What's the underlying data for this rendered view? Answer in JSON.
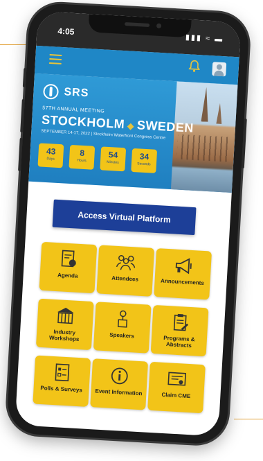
{
  "status_bar": {
    "time": "4:05",
    "signal_icons": "▮▮▮ ≈ ▬"
  },
  "app_bar": {
    "menu_icon": "menu-icon",
    "bell_icon": "bell-icon",
    "profile_icon": "avatar-icon"
  },
  "banner": {
    "logo_text": "SRS",
    "meeting_text": "57TH ANNUAL MEETING",
    "city_left": "STOCKHOLM",
    "city_right": "SWEDEN",
    "date_text": "SEPTEMBER 14-17, 2022 | Stockholm Waterfront Congress Centre",
    "countdown": [
      {
        "value": "43",
        "label": "Days"
      },
      {
        "value": "8",
        "label": "Hours"
      },
      {
        "value": "54",
        "label": "Minutes"
      },
      {
        "value": "34",
        "label": "Seconds"
      }
    ]
  },
  "access_button": "Access Virtual Platform",
  "tiles": [
    {
      "label": "Agenda",
      "icon": "agenda-icon"
    },
    {
      "label": "Attendees",
      "icon": "attendees-icon"
    },
    {
      "label": "Announcements",
      "icon": "megaphone-icon"
    },
    {
      "label": "Industry Workshops",
      "icon": "building-icon"
    },
    {
      "label": "Speakers",
      "icon": "speaker-icon"
    },
    {
      "label": "Programs & Abstracts",
      "icon": "clipboard-icon"
    },
    {
      "label": "Polls & Surveys",
      "icon": "poll-icon"
    },
    {
      "label": "Event Information",
      "icon": "info-icon"
    },
    {
      "label": "Claim CME",
      "icon": "certificate-icon"
    }
  ],
  "colors": {
    "app_blue": "#1f87c6",
    "accent_yellow": "#f2c418",
    "button_navy": "#1d3f98"
  }
}
